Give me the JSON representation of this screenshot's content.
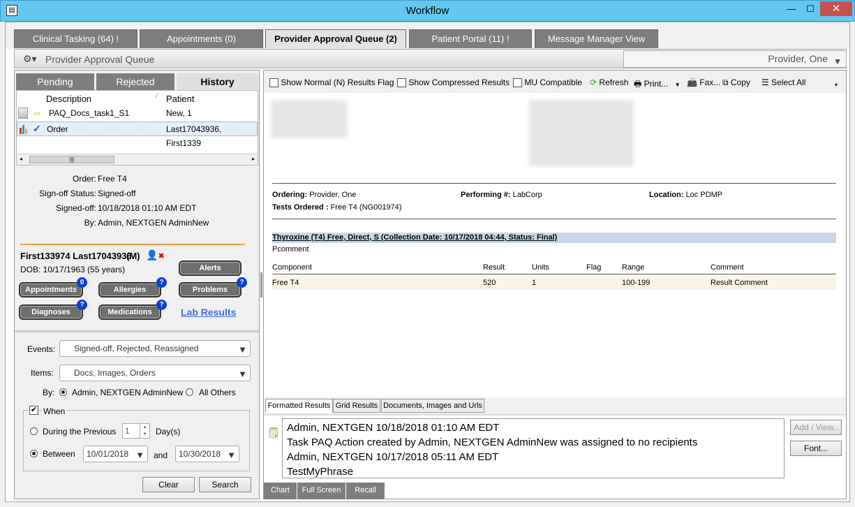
{
  "window": {
    "title": "Workflow",
    "min": "—",
    "max": "☐",
    "close": "✕"
  },
  "tabs": [
    {
      "label": "Clinical Tasking (64) !"
    },
    {
      "label": "Appointments (0)"
    },
    {
      "label": "Provider Approval Queue (2)"
    },
    {
      "label": "Patient Portal (11) !"
    },
    {
      "label": "Message Manager View"
    }
  ],
  "subheader": {
    "title": "Provider Approval Queue",
    "provider": "Provider, One"
  },
  "left": {
    "tabs": [
      "Pending",
      "Rejected",
      "History"
    ],
    "grid": {
      "headers": [
        "Description",
        "Patient"
      ],
      "rows": [
        {
          "description": "PAQ_Docs_task1_S1",
          "patient": "New, 1"
        },
        {
          "description": "Order",
          "patient": "Last17043936, First1339"
        }
      ]
    },
    "details": {
      "order_label": "Order:",
      "order": "Free T4",
      "signoff_label": "Sign-off Status:",
      "signoff": "Signed-off",
      "signedoff_label": "Signed-off:",
      "signedoff": "10/18/2018 01:10 AM EDT",
      "by_label": "By:",
      "by": "Admin, NEXTGEN AdminNew"
    },
    "patient": {
      "name": "First133974 Last17043936",
      "sex": "(M)",
      "dob": "DOB: 10/17/1963 (55 years)",
      "buttons": {
        "alerts": "Alerts",
        "appointments": "Appointments",
        "allergies": "Allergies",
        "problems": "Problems",
        "diagnoses": "Diagnoses",
        "medications": "Medications"
      },
      "badges": {
        "appointments": "0",
        "allergies": "?",
        "problems": "?",
        "diagnoses": "?",
        "medications": "?"
      },
      "lab_results": "Lab Results"
    },
    "filters": {
      "events_label": "Events:",
      "events_value": "Signed-off, Rejected, Reassigned",
      "items_label": "Items:",
      "items_value": "Docs, Images, Orders",
      "by_label": "By:",
      "by_self": "Admin, NEXTGEN AdminNew",
      "by_others": "All Others",
      "when_label": "When",
      "during_label": "During the Previous",
      "during_value": "1",
      "days_label": "Day(s)",
      "between_label": "Between",
      "from_date": "10/01/2018",
      "and_label": "and",
      "to_date": "10/30/2018",
      "clear": "Clear",
      "search": "Search"
    }
  },
  "right": {
    "toolbar": {
      "show_normal": "Show Normal (N) Results Flag",
      "show_compressed": "Show Compressed Results",
      "mu_compatible": "MU Compatible",
      "refresh": "Refresh",
      "print": "Print...",
      "fax": "Fax...",
      "copy": "Copy",
      "select_all": "Select All"
    },
    "report": {
      "ordering_label": "Ordering:",
      "ordering": "Provider, One",
      "performing_label": "Performing #:",
      "performing": "LabCorp",
      "location_label": "Location:",
      "location": "Loc PDMP",
      "tests_label": "Tests Ordered :",
      "tests": "Free T4 (NG001974)",
      "section_title": "Thyroxine (T4) Free, Direct, S (Collection Date: 10/17/2018 04:44, Status: Final)",
      "pcomment": "Pcomment",
      "columns": [
        "Component",
        "Result",
        "Units",
        "Flag",
        "Range",
        "Comment"
      ],
      "rows": [
        {
          "component": "Free T4",
          "result": "520",
          "units": "1",
          "flag": "",
          "range": "100-199",
          "comment": "Result Comment"
        }
      ]
    },
    "bottom_tabs": [
      "Formatted Results",
      "Grid Results",
      "Documents, Images and Urls"
    ],
    "notes": [
      "Admin,  NEXTGEN   10/18/2018 01:10 AM EDT",
      "Task PAQ Action created by Admin, NEXTGEN AdminNew was assigned to no recipients",
      "Admin,  NEXTGEN   10/17/2018 05:11 AM EDT",
      "TestMyPhrase"
    ],
    "add_view": "Add / View..",
    "font": "Font...",
    "footer_tabs": [
      "Chart",
      "Full Screen",
      "Recall"
    ]
  }
}
